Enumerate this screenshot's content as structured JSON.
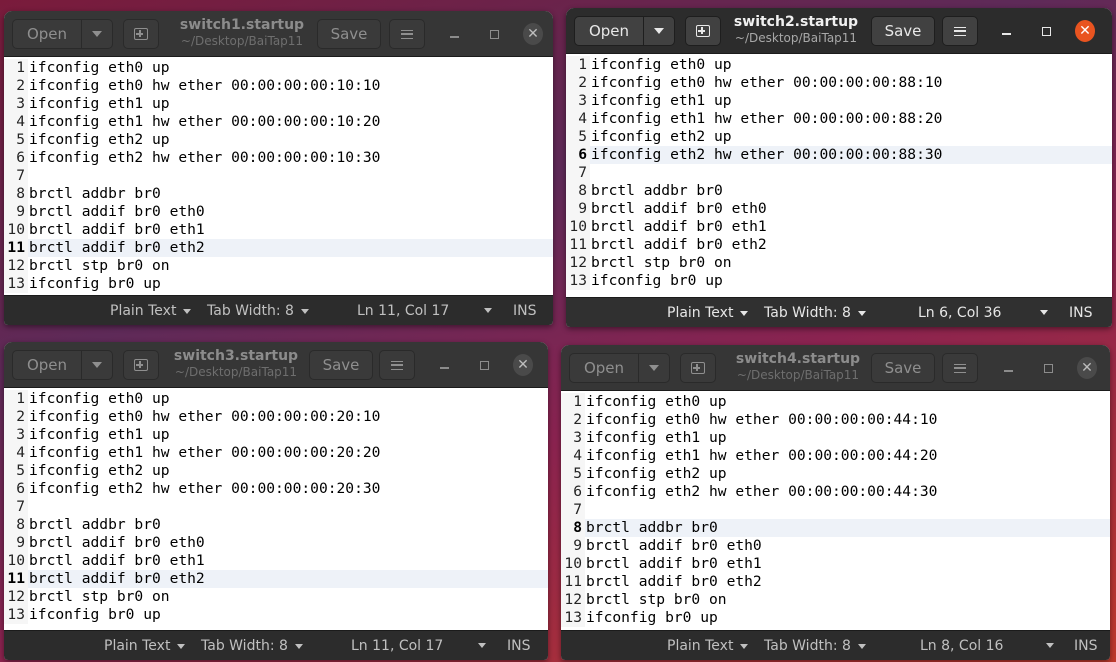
{
  "common": {
    "open_label": "Open",
    "save_label": "Save",
    "path": "~/Desktop/BaiTap11",
    "syntax": "Plain Text",
    "tab_width": "Tab Width: 8",
    "ins": "INS",
    "close_glyph": "✕",
    "icons": [
      "open-menu-arrow-icon",
      "new-document-icon",
      "hamburger-menu-icon",
      "minimize-icon",
      "maximize-icon",
      "close-icon",
      "dropdown-caret-icon"
    ]
  },
  "colors": {
    "titlebar": "#2c2c2c",
    "close_active": "#e95420",
    "current_line": "#eef2f8"
  },
  "windows": [
    {
      "title": "switch1.startup",
      "position": "ln 11, col 17",
      "cursor": "Ln 11, Col 17",
      "current_line": 11,
      "state": "inactive",
      "lines": [
        "ifconfig eth0 up",
        "ifconfig eth0 hw ether 00:00:00:00:10:10",
        "ifconfig eth1 up",
        "ifconfig eth1 hw ether 00:00:00:00:10:20",
        "ifconfig eth2 up",
        "ifconfig eth2 hw ether 00:00:00:00:10:30",
        "",
        "brctl addbr br0",
        "brctl addif br0 eth0",
        "brctl addif br0 eth1",
        "brctl addif br0 eth2",
        "brctl stp br0 on",
        "ifconfig br0 up"
      ]
    },
    {
      "title": "switch2.startup",
      "cursor": "Ln 6, Col 36",
      "current_line": 6,
      "state": "active",
      "lines": [
        "ifconfig eth0 up",
        "ifconfig eth0 hw ether 00:00:00:00:88:10",
        "ifconfig eth1 up",
        "ifconfig eth1 hw ether 00:00:00:00:88:20",
        "ifconfig eth2 up",
        "ifconfig eth2 hw ether 00:00:00:00:88:30",
        "",
        "brctl addbr br0",
        "brctl addif br0 eth0",
        "brctl addif br0 eth1",
        "brctl addif br0 eth2",
        "brctl stp br0 on",
        "ifconfig br0 up"
      ]
    },
    {
      "title": "switch3.startup",
      "cursor": "Ln 11, Col 17",
      "current_line": 11,
      "state": "inactive",
      "lines": [
        "ifconfig eth0 up",
        "ifconfig eth0 hw ether 00:00:00:00:20:10",
        "ifconfig eth1 up",
        "ifconfig eth1 hw ether 00:00:00:00:20:20",
        "ifconfig eth2 up",
        "ifconfig eth2 hw ether 00:00:00:00:20:30",
        "",
        "brctl addbr br0",
        "brctl addif br0 eth0",
        "brctl addif br0 eth1",
        "brctl addif br0 eth2",
        "brctl stp br0 on",
        "ifconfig br0 up"
      ]
    },
    {
      "title": "switch4.startup",
      "cursor": "Ln 8, Col 16",
      "current_line": 8,
      "state": "inactive",
      "lines": [
        "ifconfig eth0 up",
        "ifconfig eth0 hw ether 00:00:00:00:44:10",
        "ifconfig eth1 up",
        "ifconfig eth1 hw ether 00:00:00:00:44:20",
        "ifconfig eth2 up",
        "ifconfig eth2 hw ether 00:00:00:00:44:30",
        "",
        "brctl addbr br0",
        "brctl addif br0 eth0",
        "brctl addif br0 eth1",
        "brctl addif br0 eth2",
        "brctl stp br0 on",
        "ifconfig br0 up"
      ]
    }
  ]
}
